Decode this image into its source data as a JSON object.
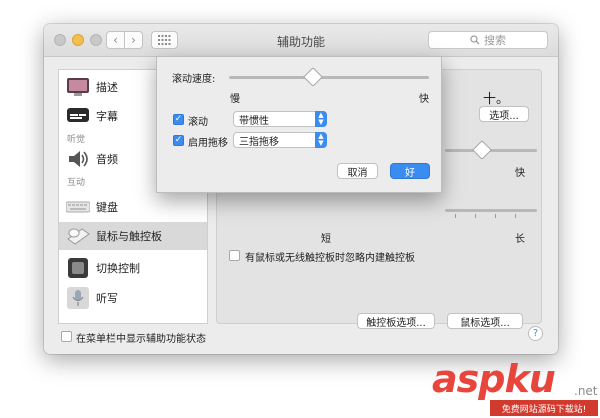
{
  "window": {
    "title": "辅助功能",
    "search_placeholder": "搜索"
  },
  "sidebar": {
    "items": [
      {
        "label": "描述",
        "icon": "display-icon"
      },
      {
        "label": "字幕",
        "icon": "captions-icon"
      },
      {
        "header": "听觉"
      },
      {
        "label": "音频",
        "icon": "speaker-icon"
      },
      {
        "header": "互动"
      },
      {
        "label": "键盘",
        "icon": "keyboard-icon"
      },
      {
        "label": "鼠标与触控板",
        "icon": "trackpad-icon",
        "selected": true
      },
      {
        "label": "切换控制",
        "icon": "switch-control-icon"
      },
      {
        "label": "听写",
        "icon": "microphone-icon"
      }
    ]
  },
  "content": {
    "options_button": "选项...",
    "slider1": {
      "max_label": "快"
    },
    "slider2": {
      "min_label": "短",
      "max_label": "长"
    },
    "ignore_trackpad_checkbox": {
      "label": "有鼠标或无线触控板时忽略内建触控板",
      "checked": false
    },
    "trackpad_options_button": "触控板选项...",
    "mouse_options_button": "鼠标选项..."
  },
  "footer": {
    "show_status_checkbox": {
      "label": "在菜单栏中显示辅助功能状态",
      "checked": false
    }
  },
  "sheet": {
    "scroll_speed_label": "滚动速度:",
    "scroll_speed": {
      "min_label": "慢",
      "max_label": "快",
      "value_fraction": 0.42
    },
    "scrolling": {
      "label": "滚动",
      "checked": true,
      "value": "带惯性"
    },
    "dragging": {
      "label": "启用拖移",
      "checked": true,
      "value": "三指拖移"
    },
    "cancel_button": "取消",
    "ok_button": "好",
    "partial_char": "十。"
  },
  "watermark": {
    "logo": "aspku",
    "tld": ".net",
    "sub": "免费网站源码下载站!"
  },
  "colors": {
    "accent": "#3b8cf0",
    "watermark_red": "#e8453c"
  }
}
